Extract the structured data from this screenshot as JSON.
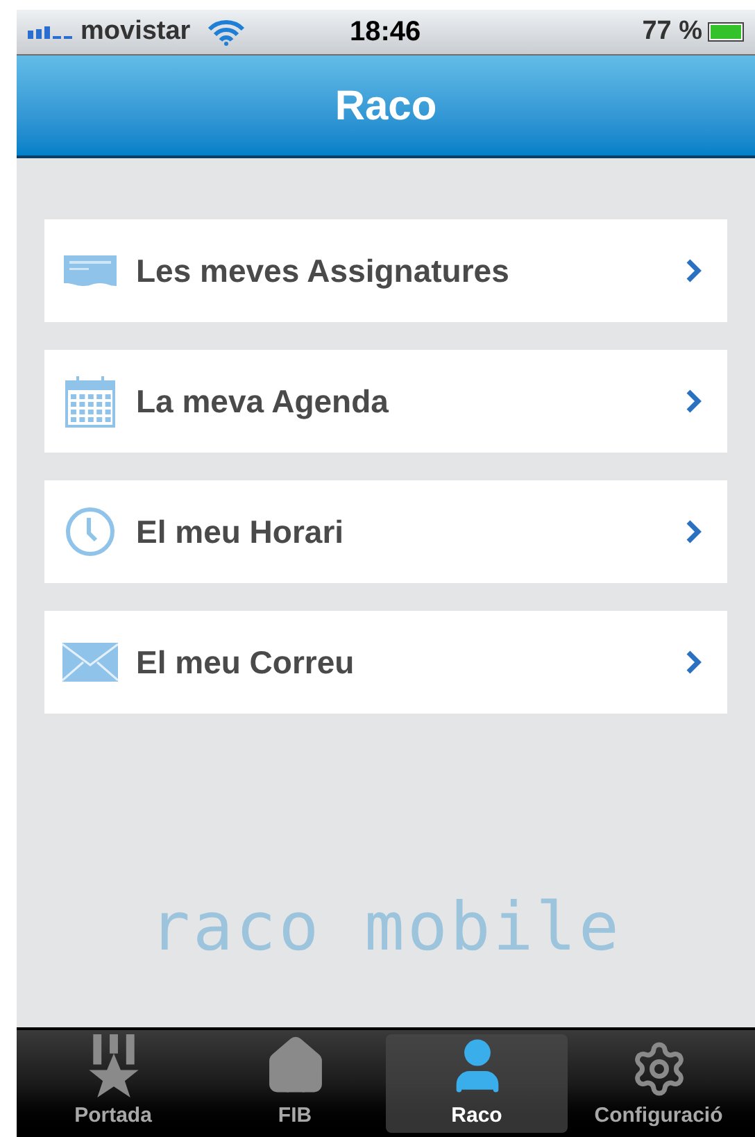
{
  "status_bar": {
    "carrier": "movistar",
    "time": "18:46",
    "battery": "77 %"
  },
  "nav_bar": {
    "title": "Raco"
  },
  "menu": [
    {
      "kind": "subjects",
      "label": "Les meves Assignatures"
    },
    {
      "kind": "calendar",
      "label": "La meva Agenda"
    },
    {
      "kind": "clock",
      "label": "El meu Horari"
    },
    {
      "kind": "mail",
      "label": "El meu Correu"
    }
  ],
  "logo": "raco mobile",
  "tab_bar": [
    {
      "kind": "medal",
      "label": "Portada",
      "selected": false
    },
    {
      "kind": "home",
      "label": "FIB",
      "selected": false
    },
    {
      "kind": "user",
      "label": "Raco",
      "selected": true
    },
    {
      "kind": "gears",
      "label": "Configuració",
      "selected": false
    }
  ]
}
